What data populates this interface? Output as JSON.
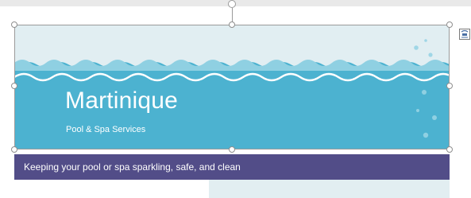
{
  "banner": {
    "title": "Martinique",
    "subtitle": "Pool & Spa Services",
    "colors": {
      "water": "#4cb2d0",
      "water_light": "#7cc9de",
      "sky": "#e1eef2",
      "bubble": "#9fd6e6"
    }
  },
  "tagline": {
    "text": "Keeping your pool or spa sparkling, safe, and clean",
    "background": "#524d88"
  },
  "layout_options": {
    "icon": "layout-options-icon"
  },
  "rotate_handle": {
    "icon": "rotate-handle-icon"
  }
}
